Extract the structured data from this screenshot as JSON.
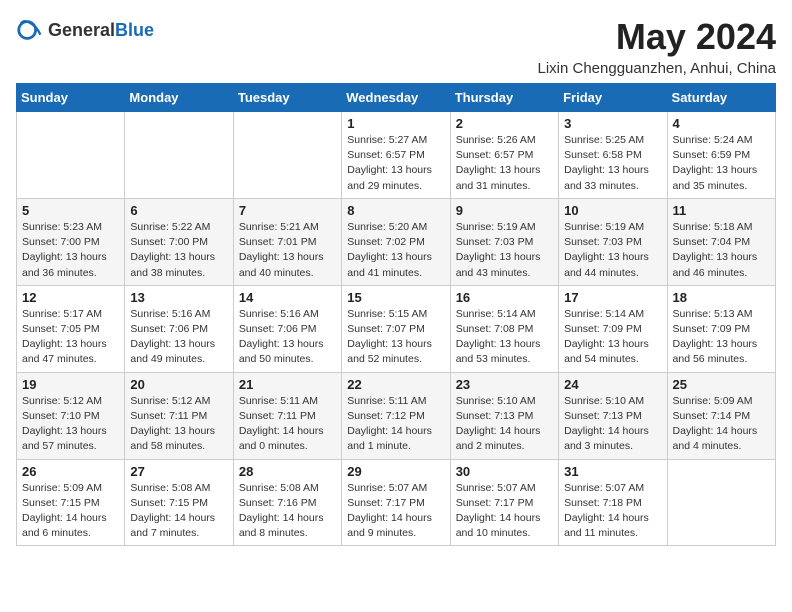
{
  "header": {
    "logo_general": "General",
    "logo_blue": "Blue",
    "title": "May 2024",
    "location": "Lixin Chengguanzhen, Anhui, China"
  },
  "weekdays": [
    "Sunday",
    "Monday",
    "Tuesday",
    "Wednesday",
    "Thursday",
    "Friday",
    "Saturday"
  ],
  "weeks": [
    [
      null,
      null,
      null,
      {
        "day": "1",
        "sunrise": "Sunrise: 5:27 AM",
        "sunset": "Sunset: 6:57 PM",
        "daylight": "Daylight: 13 hours and 29 minutes."
      },
      {
        "day": "2",
        "sunrise": "Sunrise: 5:26 AM",
        "sunset": "Sunset: 6:57 PM",
        "daylight": "Daylight: 13 hours and 31 minutes."
      },
      {
        "day": "3",
        "sunrise": "Sunrise: 5:25 AM",
        "sunset": "Sunset: 6:58 PM",
        "daylight": "Daylight: 13 hours and 33 minutes."
      },
      {
        "day": "4",
        "sunrise": "Sunrise: 5:24 AM",
        "sunset": "Sunset: 6:59 PM",
        "daylight": "Daylight: 13 hours and 35 minutes."
      }
    ],
    [
      {
        "day": "5",
        "sunrise": "Sunrise: 5:23 AM",
        "sunset": "Sunset: 7:00 PM",
        "daylight": "Daylight: 13 hours and 36 minutes."
      },
      {
        "day": "6",
        "sunrise": "Sunrise: 5:22 AM",
        "sunset": "Sunset: 7:00 PM",
        "daylight": "Daylight: 13 hours and 38 minutes."
      },
      {
        "day": "7",
        "sunrise": "Sunrise: 5:21 AM",
        "sunset": "Sunset: 7:01 PM",
        "daylight": "Daylight: 13 hours and 40 minutes."
      },
      {
        "day": "8",
        "sunrise": "Sunrise: 5:20 AM",
        "sunset": "Sunset: 7:02 PM",
        "daylight": "Daylight: 13 hours and 41 minutes."
      },
      {
        "day": "9",
        "sunrise": "Sunrise: 5:19 AM",
        "sunset": "Sunset: 7:03 PM",
        "daylight": "Daylight: 13 hours and 43 minutes."
      },
      {
        "day": "10",
        "sunrise": "Sunrise: 5:19 AM",
        "sunset": "Sunset: 7:03 PM",
        "daylight": "Daylight: 13 hours and 44 minutes."
      },
      {
        "day": "11",
        "sunrise": "Sunrise: 5:18 AM",
        "sunset": "Sunset: 7:04 PM",
        "daylight": "Daylight: 13 hours and 46 minutes."
      }
    ],
    [
      {
        "day": "12",
        "sunrise": "Sunrise: 5:17 AM",
        "sunset": "Sunset: 7:05 PM",
        "daylight": "Daylight: 13 hours and 47 minutes."
      },
      {
        "day": "13",
        "sunrise": "Sunrise: 5:16 AM",
        "sunset": "Sunset: 7:06 PM",
        "daylight": "Daylight: 13 hours and 49 minutes."
      },
      {
        "day": "14",
        "sunrise": "Sunrise: 5:16 AM",
        "sunset": "Sunset: 7:06 PM",
        "daylight": "Daylight: 13 hours and 50 minutes."
      },
      {
        "day": "15",
        "sunrise": "Sunrise: 5:15 AM",
        "sunset": "Sunset: 7:07 PM",
        "daylight": "Daylight: 13 hours and 52 minutes."
      },
      {
        "day": "16",
        "sunrise": "Sunrise: 5:14 AM",
        "sunset": "Sunset: 7:08 PM",
        "daylight": "Daylight: 13 hours and 53 minutes."
      },
      {
        "day": "17",
        "sunrise": "Sunrise: 5:14 AM",
        "sunset": "Sunset: 7:09 PM",
        "daylight": "Daylight: 13 hours and 54 minutes."
      },
      {
        "day": "18",
        "sunrise": "Sunrise: 5:13 AM",
        "sunset": "Sunset: 7:09 PM",
        "daylight": "Daylight: 13 hours and 56 minutes."
      }
    ],
    [
      {
        "day": "19",
        "sunrise": "Sunrise: 5:12 AM",
        "sunset": "Sunset: 7:10 PM",
        "daylight": "Daylight: 13 hours and 57 minutes."
      },
      {
        "day": "20",
        "sunrise": "Sunrise: 5:12 AM",
        "sunset": "Sunset: 7:11 PM",
        "daylight": "Daylight: 13 hours and 58 minutes."
      },
      {
        "day": "21",
        "sunrise": "Sunrise: 5:11 AM",
        "sunset": "Sunset: 7:11 PM",
        "daylight": "Daylight: 14 hours and 0 minutes."
      },
      {
        "day": "22",
        "sunrise": "Sunrise: 5:11 AM",
        "sunset": "Sunset: 7:12 PM",
        "daylight": "Daylight: 14 hours and 1 minute."
      },
      {
        "day": "23",
        "sunrise": "Sunrise: 5:10 AM",
        "sunset": "Sunset: 7:13 PM",
        "daylight": "Daylight: 14 hours and 2 minutes."
      },
      {
        "day": "24",
        "sunrise": "Sunrise: 5:10 AM",
        "sunset": "Sunset: 7:13 PM",
        "daylight": "Daylight: 14 hours and 3 minutes."
      },
      {
        "day": "25",
        "sunrise": "Sunrise: 5:09 AM",
        "sunset": "Sunset: 7:14 PM",
        "daylight": "Daylight: 14 hours and 4 minutes."
      }
    ],
    [
      {
        "day": "26",
        "sunrise": "Sunrise: 5:09 AM",
        "sunset": "Sunset: 7:15 PM",
        "daylight": "Daylight: 14 hours and 6 minutes."
      },
      {
        "day": "27",
        "sunrise": "Sunrise: 5:08 AM",
        "sunset": "Sunset: 7:15 PM",
        "daylight": "Daylight: 14 hours and 7 minutes."
      },
      {
        "day": "28",
        "sunrise": "Sunrise: 5:08 AM",
        "sunset": "Sunset: 7:16 PM",
        "daylight": "Daylight: 14 hours and 8 minutes."
      },
      {
        "day": "29",
        "sunrise": "Sunrise: 5:07 AM",
        "sunset": "Sunset: 7:17 PM",
        "daylight": "Daylight: 14 hours and 9 minutes."
      },
      {
        "day": "30",
        "sunrise": "Sunrise: 5:07 AM",
        "sunset": "Sunset: 7:17 PM",
        "daylight": "Daylight: 14 hours and 10 minutes."
      },
      {
        "day": "31",
        "sunrise": "Sunrise: 5:07 AM",
        "sunset": "Sunset: 7:18 PM",
        "daylight": "Daylight: 14 hours and 11 minutes."
      },
      null
    ]
  ]
}
